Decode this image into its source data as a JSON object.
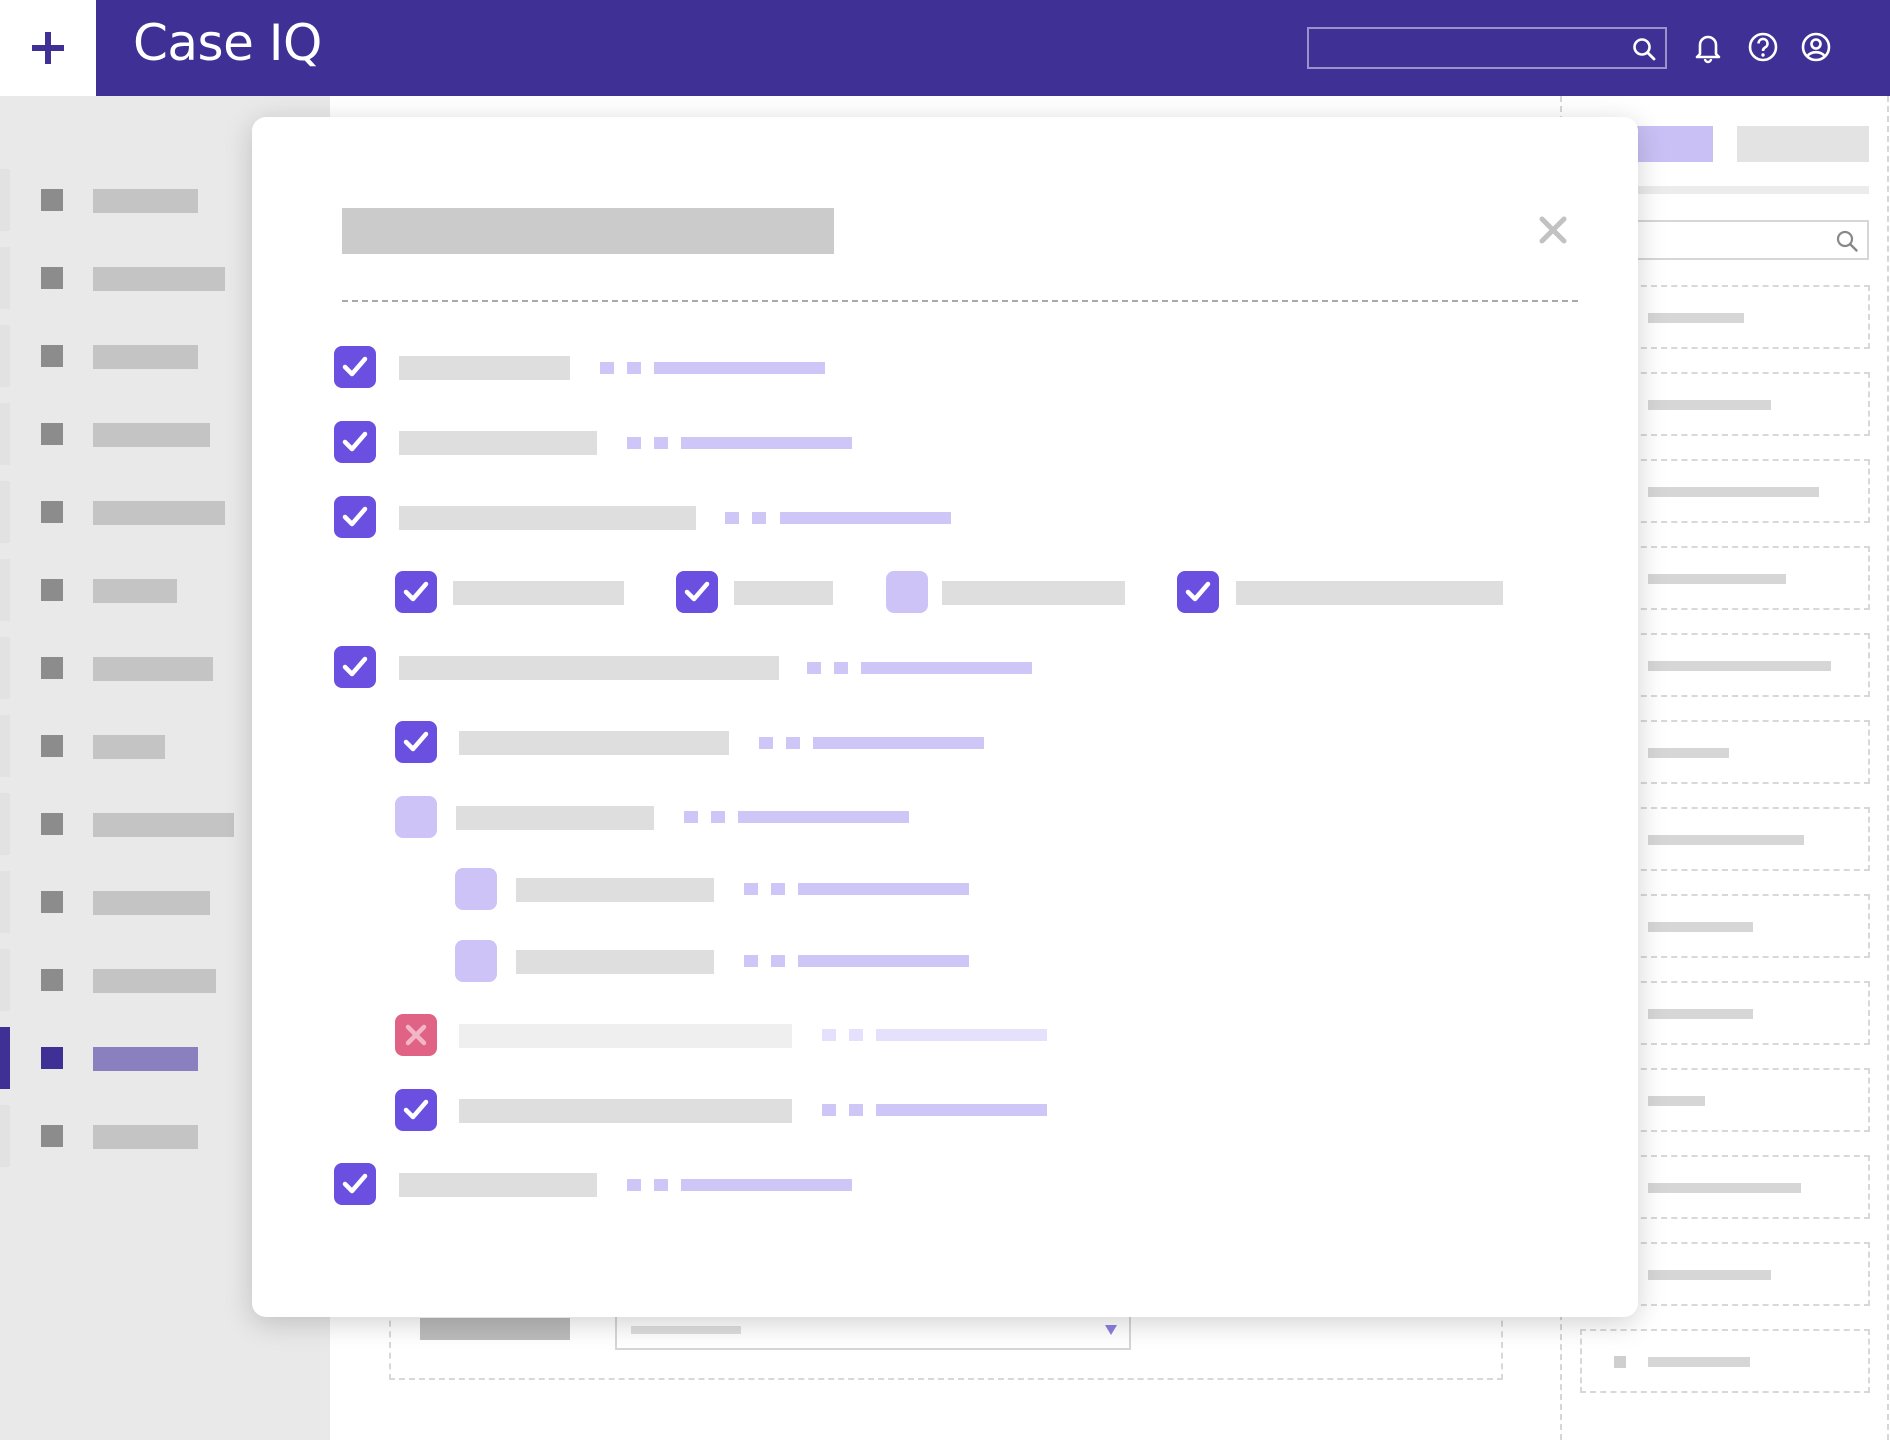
{
  "app": {
    "brand": "Case IQ",
    "colors": {
      "header": "#3f3096",
      "checkbox_on": "#6b4fe0",
      "checkbox_off": "#cdc3f7",
      "checkbox_error": "#e06285",
      "placeholder_text": "#dedede",
      "link_placeholder": "#cec6f6"
    }
  },
  "header": {
    "search": {
      "placeholder": ""
    },
    "icons": [
      "search-icon",
      "bell-icon",
      "help-icon",
      "account-icon"
    ]
  },
  "sidebar": {
    "item_count": 13,
    "active_index": 11
  },
  "modal": {
    "title": "",
    "close_icon": "close-icon",
    "checklist": [
      {
        "level": 0,
        "state": "checked"
      },
      {
        "level": 0,
        "state": "checked"
      },
      {
        "level": 0,
        "state": "checked"
      },
      {
        "level": 1,
        "state": "checked",
        "inline": true
      },
      {
        "level": 1,
        "state": "checked",
        "inline": true
      },
      {
        "level": 1,
        "state": "unchecked",
        "inline": true
      },
      {
        "level": 1,
        "state": "checked",
        "inline": true
      },
      {
        "level": 0,
        "state": "checked"
      },
      {
        "level": 1,
        "state": "checked"
      },
      {
        "level": 1,
        "state": "unchecked"
      },
      {
        "level": 2,
        "state": "unchecked"
      },
      {
        "level": 2,
        "state": "unchecked"
      },
      {
        "level": 1,
        "state": "error"
      },
      {
        "level": 1,
        "state": "checked"
      },
      {
        "level": 0,
        "state": "checked"
      }
    ]
  },
  "right_panel": {
    "card_count": 13
  }
}
